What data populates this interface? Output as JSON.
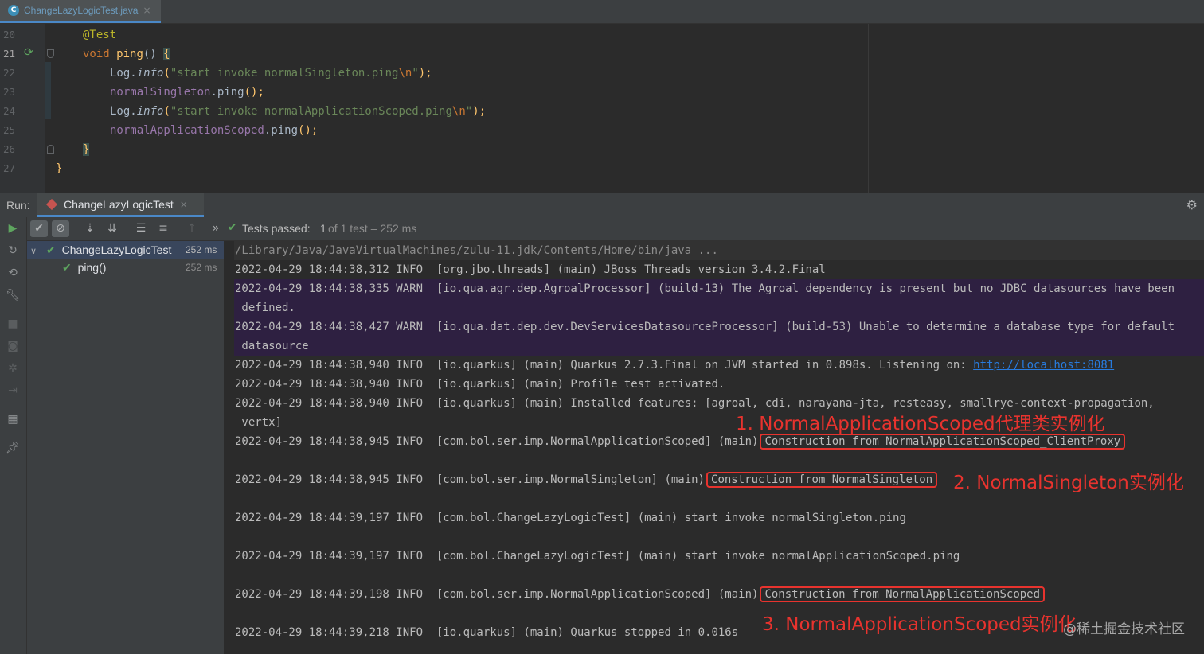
{
  "editor_tab": {
    "icon": "java-class-icon",
    "label": "ChangeLazyLogicTest.java",
    "close": "×"
  },
  "editor": {
    "line_numbers": [
      "20",
      "21",
      "22",
      "23",
      "24",
      "25",
      "26",
      "27"
    ],
    "code": {
      "annotation": "@Test",
      "kw_void": "void",
      "method": "ping",
      "parens": "()",
      "brace_open": "{",
      "log": "Log.",
      "info": "info",
      "paren_open": "(",
      "str1": "\"start invoke normalSingleton.ping",
      "esc": "\\n",
      "quote": "\"",
      "close_stmt": ");",
      "field1": "normalSingleton",
      "dot_ping": ".ping",
      "call_end": "();",
      "str2": "\"start invoke normalApplicationScoped.ping",
      "field2": "normalApplicationScoped",
      "brace_close": "}"
    }
  },
  "run_panel": {
    "label": "Run:",
    "tab": "ChangeLazyLogicTest",
    "tab_close": "×",
    "settings_icon": "gear-icon",
    "status_prefix": "Tests passed:",
    "status_count": "1",
    "status_suffix": "of 1 test – 252 ms",
    "more": "»"
  },
  "tree": [
    {
      "name": "ChangeLazyLogicTest",
      "time": "252 ms"
    },
    {
      "name": "ping()",
      "time": "252 ms"
    }
  ],
  "console": {
    "cmd": "/Library/Java/JavaVirtualMachines/zulu-11.jdk/Contents/Home/bin/java ...",
    "l1": "2022-04-29 18:44:38,312 INFO  [org.jbo.threads] (main) JBoss Threads version 3.4.2.Final",
    "l2": "2022-04-29 18:44:38,335 WARN  [io.qua.agr.dep.AgroalProcessor] (build-13) The Agroal dependency is present but no JDBC datasources have been",
    "l2b": " defined.",
    "l3": "2022-04-29 18:44:38,427 WARN  [io.qua.dat.dep.dev.DevServicesDatasourceProcessor] (build-53) Unable to determine a database type for default",
    "l3b": " datasource",
    "l4": "2022-04-29 18:44:38,940 INFO  [io.quarkus] (main) Quarkus 2.7.3.Final on JVM started in 0.898s. Listening on: ",
    "l4_link": "http://localhost:8081",
    "l5": "2022-04-29 18:44:38,940 INFO  [io.quarkus] (main) Profile test activated.",
    "l6": "2022-04-29 18:44:38,940 INFO  [io.quarkus] (main) Installed features: [agroal, cdi, narayana-jta, resteasy, smallrye-context-propagation,",
    "l6b": " vertx]",
    "l7": "2022-04-29 18:44:38,945 INFO  [com.bol.ser.imp.NormalApplicationScoped] (main)",
    "l7_box": "Construction from NormalApplicationScoped_ClientProxy",
    "l8": "2022-04-29 18:44:38,945 INFO  [com.bol.ser.imp.NormalSingleton] (main)",
    "l8_box": "Construction from NormalSingleton",
    "l9": "2022-04-29 18:44:39,197 INFO  [com.bol.ChangeLazyLogicTest] (main) start invoke normalSingleton.ping",
    "l10": "2022-04-29 18:44:39,197 INFO  [com.bol.ChangeLazyLogicTest] (main) start invoke normalApplicationScoped.ping",
    "l11": "2022-04-29 18:44:39,198 INFO  [com.bol.ser.imp.NormalApplicationScoped] (main)",
    "l11_box": "Construction from NormalApplicationScoped",
    "l12": "2022-04-29 18:44:39,218 INFO  [io.quarkus] (main) Quarkus stopped in 0.016s"
  },
  "annotations": {
    "a1": "1. NormalApplicationScoped代理类实例化",
    "a2": "2. NormalSingleton实例化",
    "a3": "3. NormalApplicationScoped实例化"
  },
  "watermark": "@稀土掘金技术社区",
  "colors": {
    "annotation_red": "#e8332e",
    "warn_bg": "#2e2041",
    "link": "#287bde",
    "pass_green": "#5ea55f"
  }
}
